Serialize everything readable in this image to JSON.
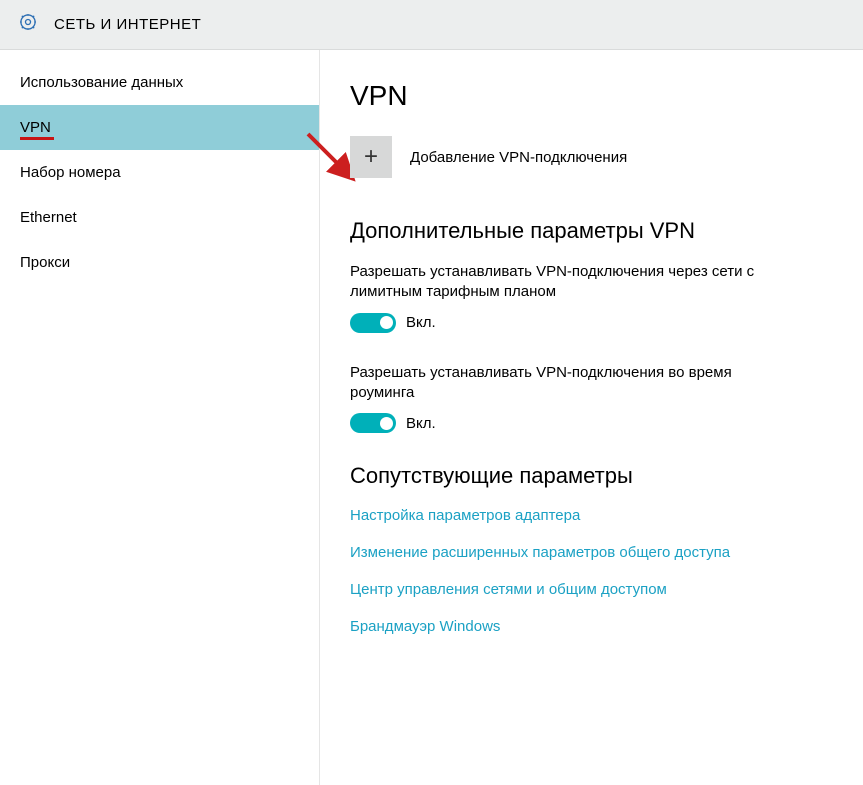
{
  "titlebar": {
    "label": "СЕТЬ И ИНТЕРНЕТ"
  },
  "sidebar": {
    "items": [
      {
        "label": "Использование данных",
        "active": false
      },
      {
        "label": "VPN",
        "active": true
      },
      {
        "label": "Набор номера",
        "active": false
      },
      {
        "label": "Ethernet",
        "active": false
      },
      {
        "label": "Прокси",
        "active": false
      }
    ]
  },
  "main": {
    "title": "VPN",
    "add_vpn_label": "Добавление VPN-подключения",
    "advanced_heading": "Дополнительные параметры VPN",
    "setting1_label": "Разрешать устанавливать VPN-подключения через сети с лимитным тарифным планом",
    "setting1_state": "Вкл.",
    "setting2_label": "Разрешать устанавливать VPN-подключения во время роуминга",
    "setting2_state": "Вкл.",
    "related_heading": "Сопутствующие параметры",
    "links": [
      "Настройка параметров адаптера",
      "Изменение расширенных параметров общего доступа",
      "Центр управления сетями и общим доступом",
      "Брандмауэр Windows"
    ]
  }
}
